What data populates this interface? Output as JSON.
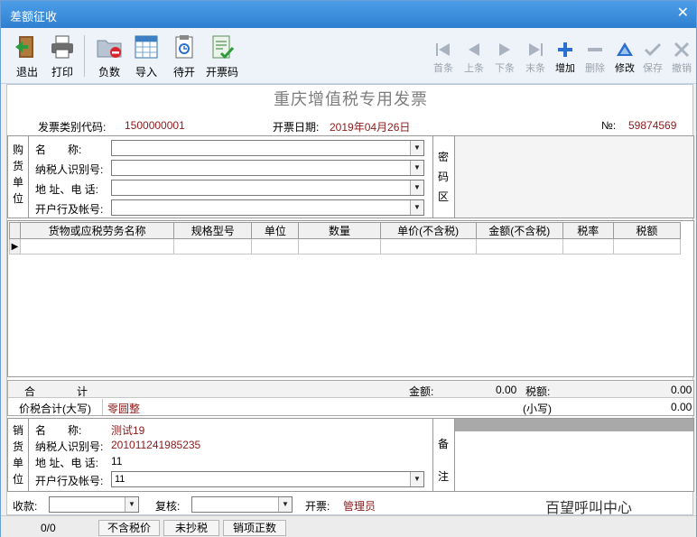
{
  "window": {
    "title": "差额征收",
    "close_glyph": "✕"
  },
  "toolbar": {
    "left_buttons": [
      {
        "label": "退出",
        "icon": "exit-door-icon"
      },
      {
        "label": "打印",
        "icon": "printer-icon"
      },
      {
        "label": "负数",
        "icon": "negative-folder-icon"
      },
      {
        "label": "导入",
        "icon": "import-grid-icon"
      },
      {
        "label": "待开",
        "icon": "pending-clipboard-icon"
      },
      {
        "label": "开票码",
        "icon": "invoice-code-icon"
      }
    ],
    "nav_buttons": [
      {
        "label": "首条",
        "icon": "first-record-icon",
        "enabled": false
      },
      {
        "label": "上条",
        "icon": "prev-record-icon",
        "enabled": false
      },
      {
        "label": "下条",
        "icon": "next-record-icon",
        "enabled": false
      },
      {
        "label": "末条",
        "icon": "last-record-icon",
        "enabled": false
      },
      {
        "label": "增加",
        "icon": "add-plus-icon",
        "enabled": true
      },
      {
        "label": "删除",
        "icon": "delete-minus-icon",
        "enabled": false
      },
      {
        "label": "修改",
        "icon": "edit-triangle-icon",
        "enabled": true
      },
      {
        "label": "保存",
        "icon": "save-check-icon",
        "enabled": false
      },
      {
        "label": "撤销",
        "icon": "undo-x-icon",
        "enabled": false
      }
    ]
  },
  "invoice": {
    "title": "重庆增值税专用发票",
    "type_code_label": "发票类别代码:",
    "type_code_value": "1500000001",
    "date_label": "开票日期:",
    "date_value": "2019年04月26日",
    "number_label": "№:",
    "number_value": "59874569"
  },
  "buyer": {
    "side_label": [
      "购",
      "货",
      "单",
      "位"
    ],
    "fields": [
      {
        "label": "名　　称:",
        "value": ""
      },
      {
        "label": "纳税人识别号:",
        "value": ""
      },
      {
        "label": "地 址、电 话:",
        "value": ""
      },
      {
        "label": "开户行及帐号:",
        "value": ""
      }
    ],
    "cipher_label": [
      "密",
      "码",
      "区"
    ]
  },
  "items_table": {
    "columns": [
      "货物或应税劳务名称",
      "规格型号",
      "单位",
      "数量",
      "单价(不含税)",
      "金额(不含税)",
      "税率",
      "税额"
    ],
    "row_marker": "▶"
  },
  "totals": {
    "label_he": "合",
    "label_ji": "计",
    "amount_label": "金额:",
    "amount_value": "0.00",
    "tax_label": "税额:",
    "tax_value": "0.00",
    "capital_label": "价税合计(大写)",
    "capital_value": "零圆整",
    "small_label": "(小写)",
    "small_value": "0.00"
  },
  "seller": {
    "side_label": [
      "销",
      "货",
      "单",
      "位"
    ],
    "name_label": "名　　称:",
    "name_value": "测试19",
    "taxid_label": "纳税人识别号:",
    "taxid_value": "201011241985235",
    "addr_label": "地 址、电 话:",
    "addr_value": "11",
    "bank_label": "开户行及帐号:",
    "bank_value": "11",
    "remark_label": [
      "备",
      "注"
    ]
  },
  "signoff": {
    "payee_label": "收款:",
    "payee_value": "",
    "reviewer_label": "复核:",
    "reviewer_value": "",
    "drawer_label": "开票:",
    "drawer_value": "管理员"
  },
  "status_bar": {
    "counter": "0/0",
    "tabs": [
      "不含税价",
      "未抄税",
      "销项正数"
    ]
  },
  "watermark": {
    "text": "百望呼叫中心"
  },
  "colors": {
    "titlebar": "#2f7fd0",
    "accent_red": "#8b1a1a",
    "nav_blue": "#2b6fd0"
  }
}
